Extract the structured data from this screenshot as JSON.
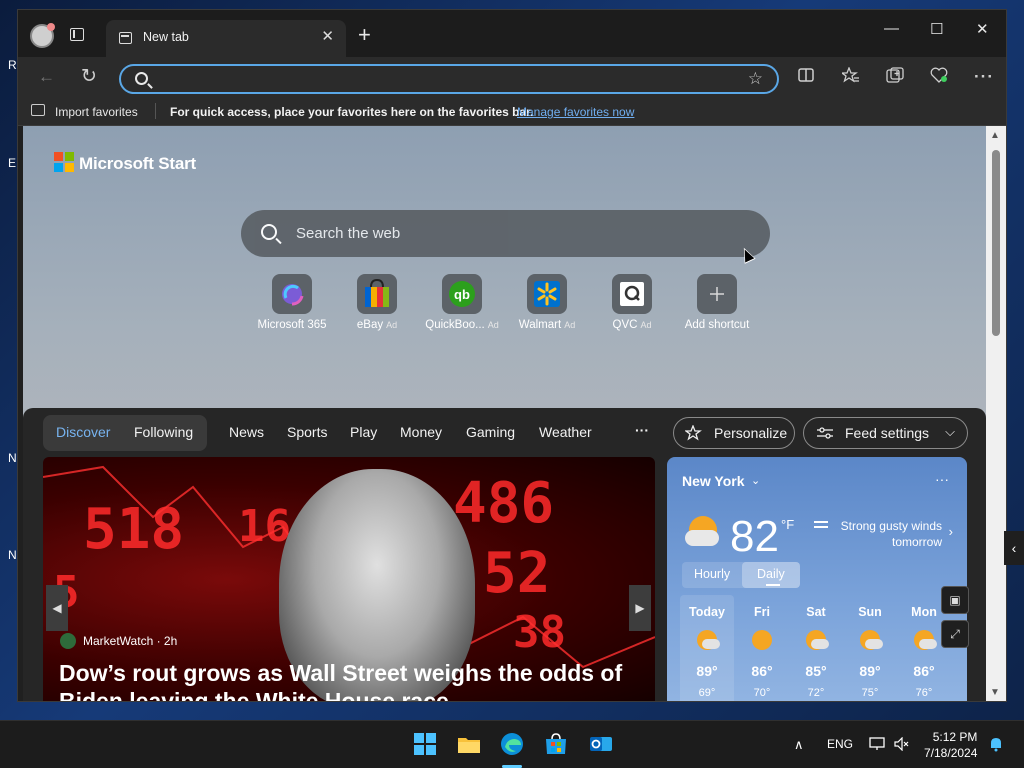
{
  "desktop": {
    "fragments": [
      "R",
      "E",
      "N",
      "N"
    ]
  },
  "tab": {
    "title": "New tab",
    "close": "✕"
  },
  "window_controls": {
    "minimize": "—",
    "maximize": "☐",
    "close": "✕"
  },
  "toolbar": {
    "back": "←",
    "refresh": "↻",
    "new_tab": "+",
    "star": "☆",
    "address_value": "",
    "address_placeholder": ""
  },
  "favbar": {
    "import": "Import favorites",
    "message": "For quick access, place your favorites here on the favorites bar.",
    "manage_link": "Manage favorites now"
  },
  "start": {
    "brand": "Microsoft Start",
    "search_placeholder": "Search the web"
  },
  "shortcuts": [
    {
      "label": "Microsoft 365",
      "ad": ""
    },
    {
      "label": "eBay",
      "ad": "Ad"
    },
    {
      "label": "QuickBoo...",
      "ad": "Ad"
    },
    {
      "label": "Walmart",
      "ad": "Ad"
    },
    {
      "label": "QVC",
      "ad": "Ad"
    },
    {
      "label": "Add shortcut",
      "ad": ""
    }
  ],
  "feed": {
    "tabs": {
      "discover": "Discover",
      "following": "Following"
    },
    "nav": [
      "News",
      "Sports",
      "Play",
      "Money",
      "Gaming",
      "Weather",
      "···"
    ],
    "personalize": "Personalize",
    "feed_settings": "Feed settings",
    "hero": {
      "ticker": [
        "518",
        "16",
        "486",
        "52",
        "38",
        "5"
      ],
      "source": "MarketWatch · 2h",
      "headline": "Dow’s rout grows as Wall Street weighs the odds of Biden leaving the White House race"
    }
  },
  "weather": {
    "city": "New York",
    "caret": "⌄",
    "more": "···",
    "temp": "82",
    "unit": "°F",
    "wind": "Strong gusty winds tomorrow",
    "toggle": {
      "hourly": "Hourly",
      "daily": "Daily"
    },
    "days": [
      {
        "name": "Today",
        "high": "89°",
        "low": "69°"
      },
      {
        "name": "Fri",
        "high": "86°",
        "low": "70°"
      },
      {
        "name": "Sat",
        "high": "85°",
        "low": "72°"
      },
      {
        "name": "Sun",
        "high": "89°",
        "low": "75°"
      },
      {
        "name": "Mon",
        "high": "86°",
        "low": "76°"
      }
    ]
  },
  "taskbar": {
    "language": "ENG",
    "time": "5:12 PM",
    "date": "7/18/2024"
  }
}
